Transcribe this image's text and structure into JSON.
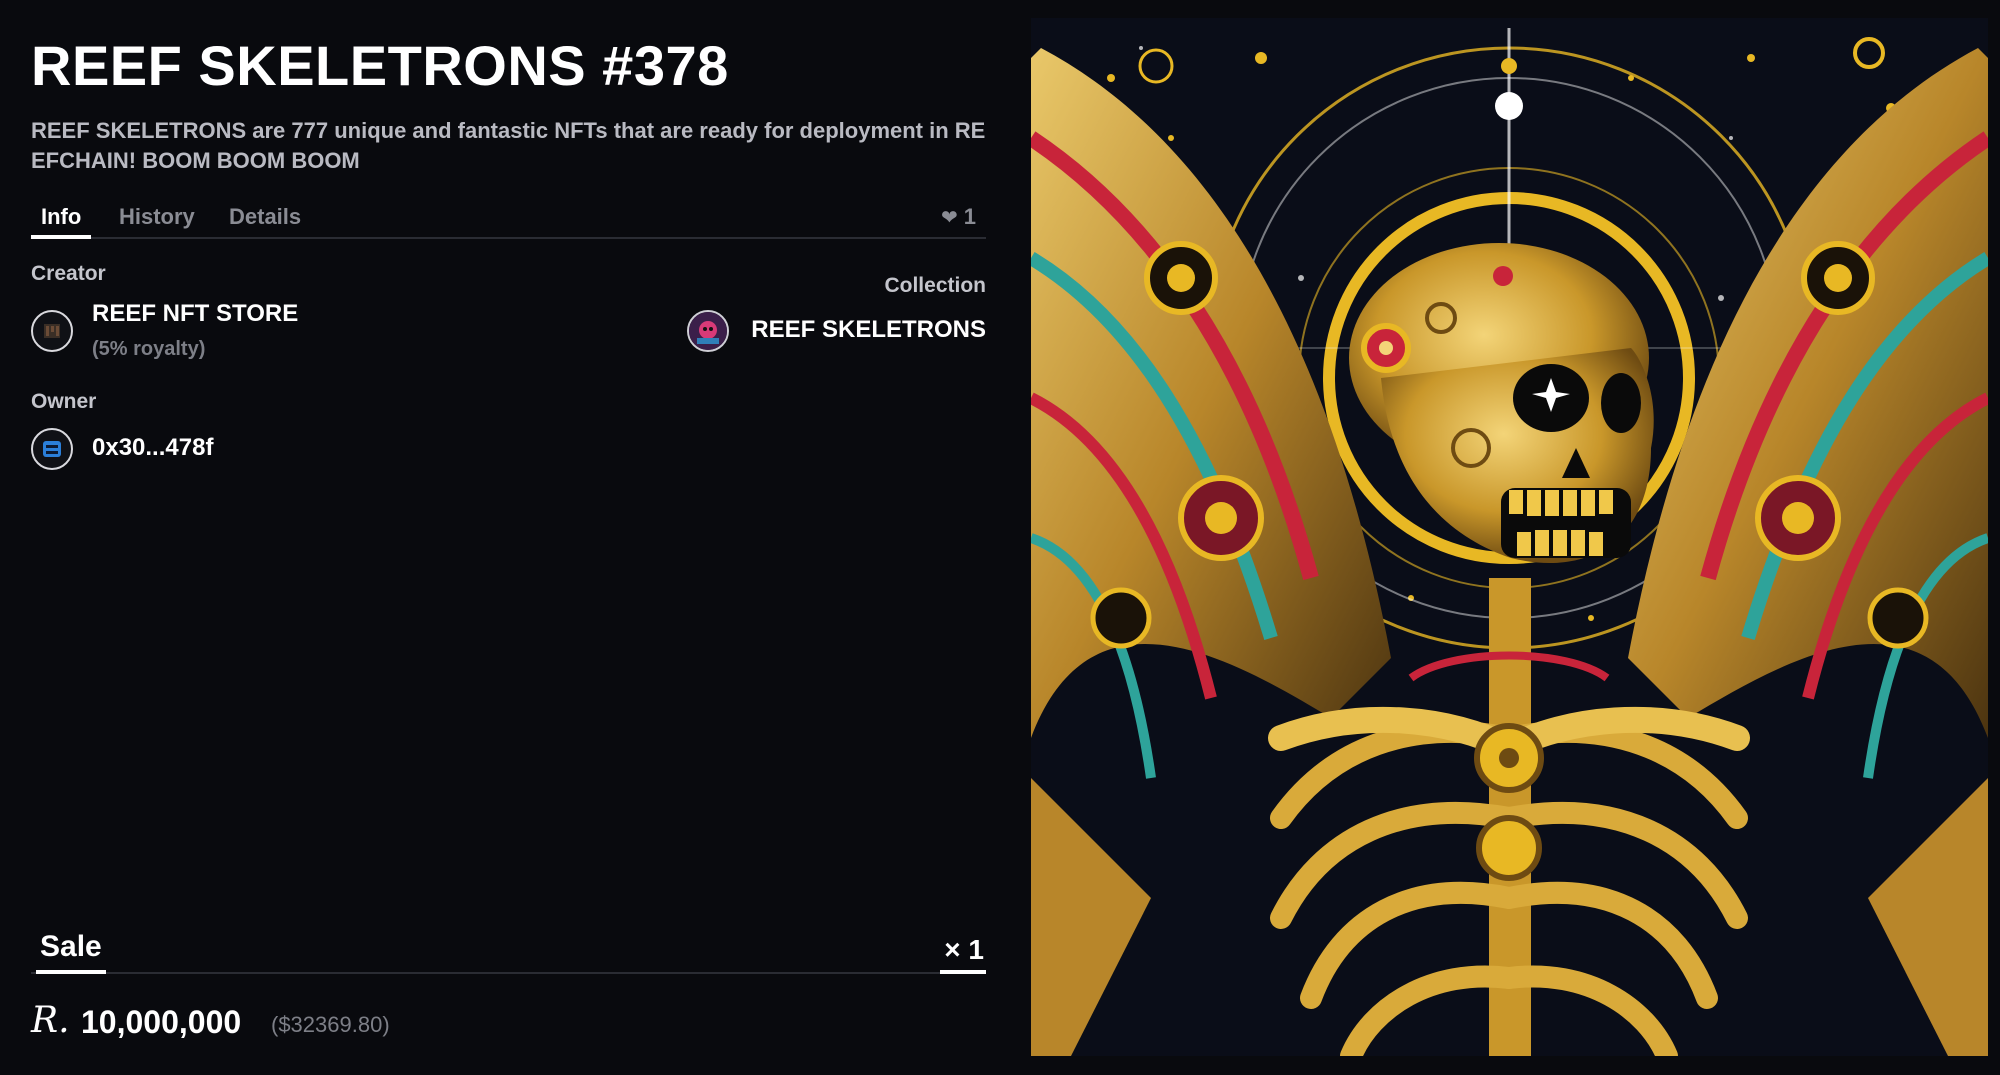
{
  "nft": {
    "title": "REEF SKELETRONS #378",
    "description": "REEF SKELETRONS are 777 unique and fantastic NFTs that are ready for deployment in REEFCHAIN! BOOM BOOM BOOM"
  },
  "tabs": [
    {
      "label": "Info",
      "active": true
    },
    {
      "label": "History",
      "active": false
    },
    {
      "label": "Details",
      "active": false
    }
  ],
  "likes": {
    "icon": "heart-icon",
    "count": "1"
  },
  "creator": {
    "label": "Creator",
    "name": "REEF NFT STORE",
    "royalty": "(5% royalty)",
    "avatar_icon": "store-avatar-icon"
  },
  "collection": {
    "label": "Collection",
    "name": "REEF SKELETRONS",
    "avatar_icon": "collection-avatar-icon"
  },
  "owner": {
    "label": "Owner",
    "address": "0x30...478f",
    "avatar_icon": "owner-avatar-icon"
  },
  "sale": {
    "tab_label": "Sale",
    "quantity": "× 1",
    "currency_symbol": "R.",
    "price": "10,000,000",
    "price_usd": "($32369.80)"
  },
  "colors": {
    "background": "#090a0e",
    "text": "#ffffff",
    "muted": "#7d7f87",
    "gold": "#e8b824",
    "crimson": "#c8243a",
    "teal": "#2ea39a"
  },
  "image": {
    "icon": "skeleton-angel-nft-image"
  }
}
